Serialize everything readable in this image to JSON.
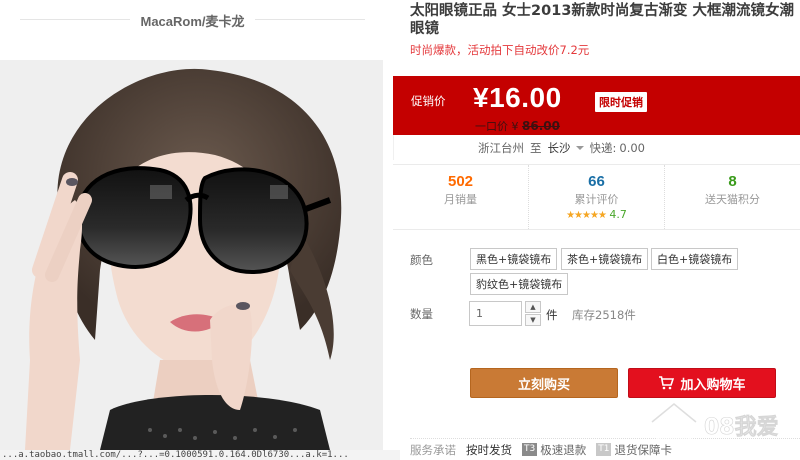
{
  "shop": {
    "name": "MacaRom/麦卡龙"
  },
  "product": {
    "title": "太阳眼镜正品 女士2013新款时尚复古渐变 大框潮流镜女潮眼镜",
    "subtitle": "时尚爆款，活动拍下自动改价7.2元"
  },
  "price": {
    "label": "促销价",
    "current": "¥16.00",
    "tag": "限时促销",
    "original_label": "一口价 ¥",
    "original_value": "86.00"
  },
  "shipping": {
    "from": "浙江台州",
    "to_word": "至",
    "to_city": "长沙",
    "express_label": "快递:",
    "express_fee": "0.00"
  },
  "stats": [
    {
      "value": "502",
      "label": "月销量"
    },
    {
      "value": "66",
      "label": "累计评价",
      "rating": "4.7",
      "stars": "★★★★★"
    },
    {
      "value": "8",
      "label": "送天猫积分"
    }
  ],
  "options": {
    "color_label": "颜色",
    "colors": [
      "黑色+镜袋镜布",
      "茶色+镜袋镜布",
      "白色+镜袋镜布",
      "豹纹色+镜袋镜布"
    ],
    "qty_label": "数量",
    "qty_value": "1",
    "qty_unit": "件",
    "stock": "库存2518件"
  },
  "actions": {
    "buy_now": "立刻购买",
    "add_to_cart": "加入购物车"
  },
  "services": {
    "label": "服务承诺",
    "items": [
      {
        "badge": "",
        "text": "按时发货"
      },
      {
        "badge": "T3",
        "text": "极速退款"
      },
      {
        "badge": "T1",
        "text": "退货保障卡"
      }
    ]
  },
  "status_bar": {
    "text": "...a.taobao.tmall.com/...?...=0.1000591.0.164.0Dl6730...a.k=1..."
  },
  "watermark": {
    "text": "08我爱"
  },
  "colors": {
    "price_red": "#c40000",
    "buy_brown": "#c97a35",
    "cart_red": "#e3101e",
    "sales_orange": "#ff6a00"
  }
}
